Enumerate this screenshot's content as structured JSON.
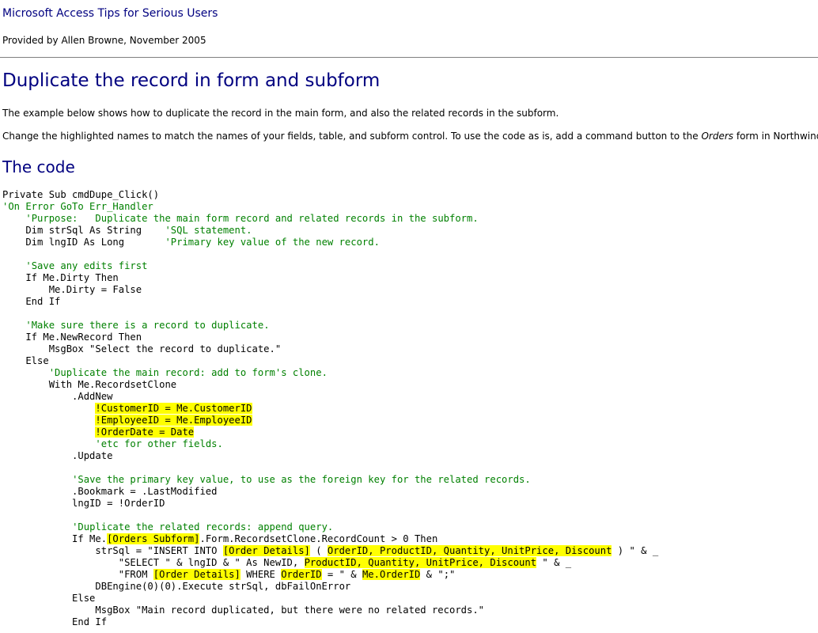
{
  "header": {
    "site_title": "Microsoft Access Tips for Serious Users",
    "byline": "Provided by Allen Browne, November 2005"
  },
  "article": {
    "title": "Duplicate the record in form and subform",
    "intro": "The example below shows how to duplicate the record in the main form, and also the related records in the subform.",
    "instructions": {
      "before": "Change the highlighted names to match the names of your fields, table, and subform control. To use the code as is, add a command button to the ",
      "emphasis": "Orders",
      "after": " form in Northwind."
    },
    "code_heading": "The code"
  },
  "code_lines": [
    [
      {
        "t": "Private Sub cmdDupe_Click()"
      }
    ],
    [
      {
        "t": "'On Error GoTo Err_Handler",
        "c": "cmt"
      }
    ],
    [
      {
        "t": "    "
      },
      {
        "t": "'Purpose:   Duplicate the main form record and related records in the subform.",
        "c": "cmt"
      }
    ],
    [
      {
        "t": "    Dim strSql As String    "
      },
      {
        "t": "'SQL statement.",
        "c": "cmt"
      }
    ],
    [
      {
        "t": "    Dim lngID As Long       "
      },
      {
        "t": "'Primary key value of the new record.",
        "c": "cmt"
      }
    ],
    [
      {
        "t": ""
      }
    ],
    [
      {
        "t": "    "
      },
      {
        "t": "'Save any edits first",
        "c": "cmt"
      }
    ],
    [
      {
        "t": "    If Me.Dirty Then"
      }
    ],
    [
      {
        "t": "        Me.Dirty = False"
      }
    ],
    [
      {
        "t": "    End If"
      }
    ],
    [
      {
        "t": ""
      }
    ],
    [
      {
        "t": "    "
      },
      {
        "t": "'Make sure there is a record to duplicate.",
        "c": "cmt"
      }
    ],
    [
      {
        "t": "    If Me.NewRecord Then"
      }
    ],
    [
      {
        "t": "        MsgBox \"Select the record to duplicate.\""
      }
    ],
    [
      {
        "t": "    Else"
      }
    ],
    [
      {
        "t": "        "
      },
      {
        "t": "'Duplicate the main record: add to form's clone.",
        "c": "cmt"
      }
    ],
    [
      {
        "t": "        With Me.RecordsetClone"
      }
    ],
    [
      {
        "t": "            .AddNew"
      }
    ],
    [
      {
        "t": "                "
      },
      {
        "t": "!CustomerID = Me.CustomerID",
        "c": "hl"
      }
    ],
    [
      {
        "t": "                "
      },
      {
        "t": "!EmployeeID = Me.EmployeeID",
        "c": "hl"
      }
    ],
    [
      {
        "t": "                "
      },
      {
        "t": "!OrderDate = Date",
        "c": "hl"
      }
    ],
    [
      {
        "t": "                "
      },
      {
        "t": "'etc for other fields.",
        "c": "cmt"
      }
    ],
    [
      {
        "t": "            .Update"
      }
    ],
    [
      {
        "t": ""
      }
    ],
    [
      {
        "t": "            "
      },
      {
        "t": "'Save the primary key value, to use as the foreign key for the related records.",
        "c": "cmt"
      }
    ],
    [
      {
        "t": "            .Bookmark = .LastModified"
      }
    ],
    [
      {
        "t": "            lngID = !OrderID"
      }
    ],
    [
      {
        "t": ""
      }
    ],
    [
      {
        "t": "            "
      },
      {
        "t": "'Duplicate the related records: append query.",
        "c": "cmt"
      }
    ],
    [
      {
        "t": "            If Me."
      },
      {
        "t": "[Orders Subform]",
        "c": "hl"
      },
      {
        "t": ".Form.RecordsetClone.RecordCount > 0 Then"
      }
    ],
    [
      {
        "t": "                strSql = \"INSERT INTO "
      },
      {
        "t": "[Order Details]",
        "c": "hl"
      },
      {
        "t": " ( "
      },
      {
        "t": "OrderID, ProductID, Quantity, UnitPrice, Discount",
        "c": "hl"
      },
      {
        "t": " ) \" & _"
      }
    ],
    [
      {
        "t": "                    \"SELECT \" & lngID & \" As NewID, "
      },
      {
        "t": "ProductID, Quantity, UnitPrice, Discount",
        "c": "hl"
      },
      {
        "t": " \" & _"
      }
    ],
    [
      {
        "t": "                    \"FROM "
      },
      {
        "t": "[Order Details]",
        "c": "hl"
      },
      {
        "t": " WHERE "
      },
      {
        "t": "OrderID",
        "c": "hl"
      },
      {
        "t": " = \" & "
      },
      {
        "t": "Me.OrderID",
        "c": "hl"
      },
      {
        "t": " & \";\""
      }
    ],
    [
      {
        "t": "                DBEngine(0)(0).Execute strSql, dbFailOnError"
      }
    ],
    [
      {
        "t": "            Else"
      }
    ],
    [
      {
        "t": "                MsgBox \"Main record duplicated, but there were no related records.\""
      }
    ],
    [
      {
        "t": "            End If"
      }
    ]
  ]
}
